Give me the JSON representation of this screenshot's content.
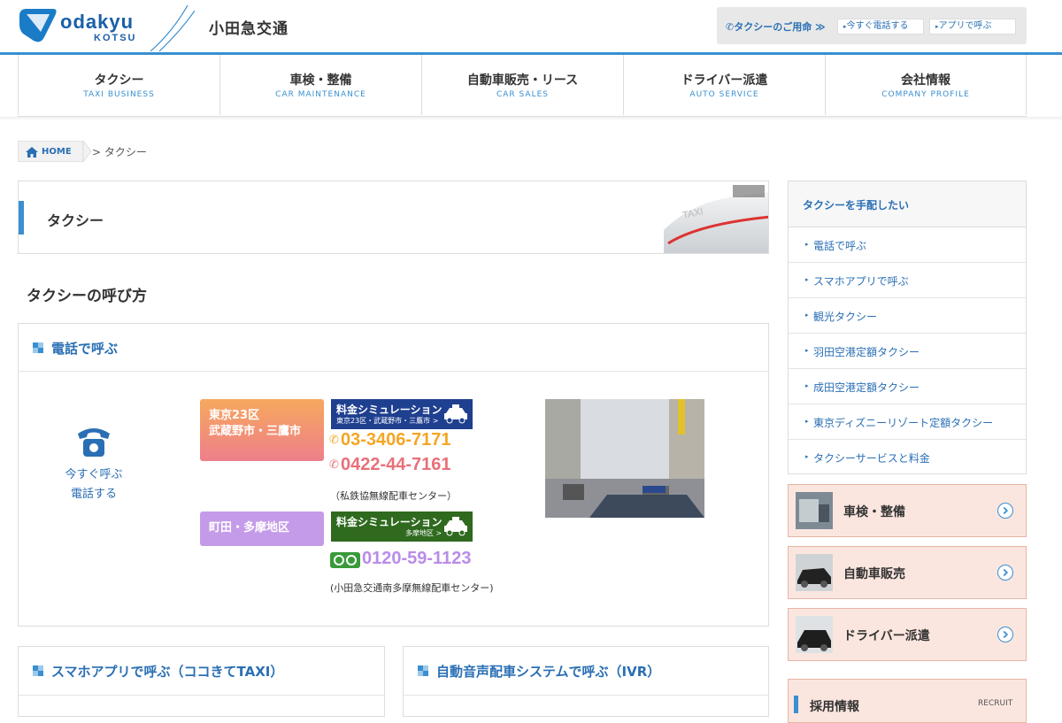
{
  "header": {
    "logo_main": "odakyu",
    "logo_sub": "KOTSU",
    "company_name": "小田急交通",
    "utility_label": "タクシーのご用命 ≫",
    "utility_buttons": [
      "今すぐ電話する",
      "アプリで呼ぶ"
    ]
  },
  "nav": [
    {
      "jp": "タクシー",
      "en": "TAXI BUSINESS"
    },
    {
      "jp": "車検・整備",
      "en": "CAR MAINTENANCE"
    },
    {
      "jp": "自動車販売・リース",
      "en": "CAR SALES"
    },
    {
      "jp": "ドライバー派遣",
      "en": "AUTO SERVICE"
    },
    {
      "jp": "会社情報",
      "en": "COMPANY PROFILE"
    }
  ],
  "breadcrumb": {
    "home": "HOME",
    "sep": ">",
    "current": "タクシー"
  },
  "page_title": "タクシー",
  "section_heading": "タクシーの呼び方",
  "phone_section": {
    "heading": "電話で呼ぶ",
    "call_now_line1": "今すぐ呼ぶ",
    "call_now_line2": "電話する",
    "area1_line1": "東京23区",
    "area1_line2": "武蔵野市・三鷹市",
    "sim1_line1": "料金シミュレーション",
    "sim1_line2": "東京23区・武蔵野市・三鷹市 >",
    "tel1": "03-3406-7171",
    "tel2": "0422-44-7161",
    "center1": "（私鉄協無線配車センター）",
    "area2": "町田・多摩地区",
    "sim2_line1": "料金シミュレーション",
    "sim2_line2": "多摩地区 >",
    "tel3": "0120-59-1123",
    "center2": "(小田急交通南多摩無線配車センター)"
  },
  "app_section": {
    "heading": "スマホアプリで呼ぶ（ココきてTAXI）"
  },
  "ivr_section": {
    "heading": "自動音声配車システムで呼ぶ（IVR）"
  },
  "sidebar": {
    "heading": "タクシーを手配したい",
    "links": [
      "電話で呼ぶ",
      "スマホアプリで呼ぶ",
      "観光タクシー",
      "羽田空港定額タクシー",
      "成田空港定額タクシー",
      "東京ディズニーリゾート定額タクシー",
      "タクシーサービスと料金"
    ]
  },
  "promos": [
    "車検・整備",
    "自動車販売",
    "ドライバー派遣"
  ],
  "recruit": {
    "jp": "採用情報",
    "en": "RECRUIT"
  },
  "colors": {
    "accent": "#3a8fd0",
    "link": "#2a6fb4",
    "area1": "#f08a7a",
    "area2": "#c49be8",
    "tel_orange": "#f5a623",
    "tel_red": "#e8707a",
    "tel_purple": "#b98ce8"
  }
}
